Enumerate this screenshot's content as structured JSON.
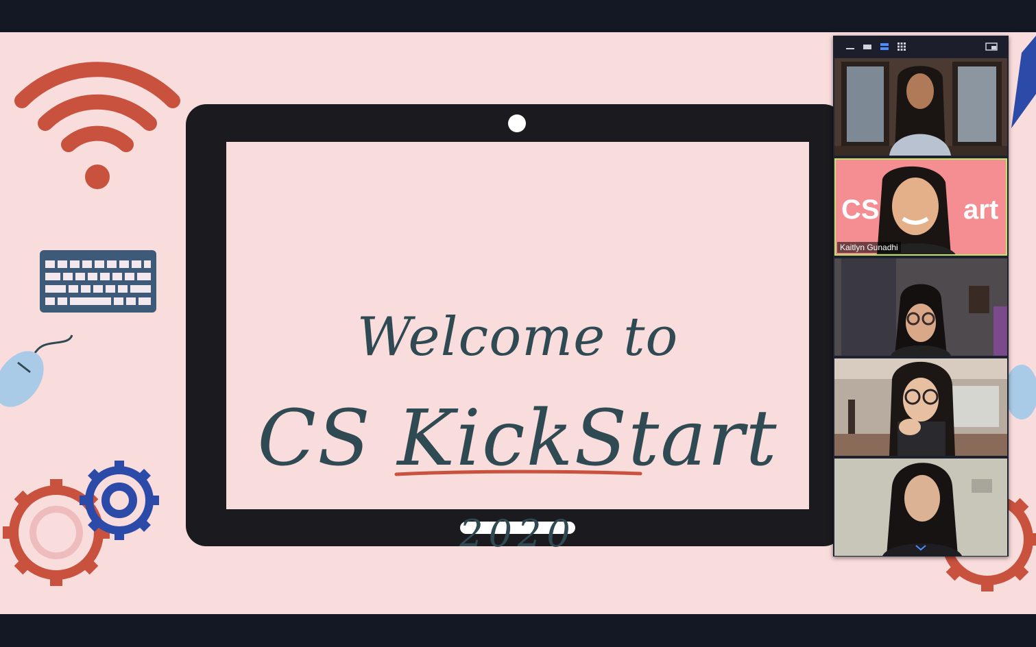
{
  "slide": {
    "line1": "Welcome to",
    "line2": "CS KickStart",
    "line3": "2020"
  },
  "colors": {
    "slide_bg": "#f9dcdc",
    "text": "#2f4a52",
    "accent_red": "#c9523f",
    "accent_blue": "#2c4aa8",
    "keyboard": "#3d5a78",
    "laptop": "#1b1b1f",
    "active_speaker": "#c4e466"
  },
  "gallery": {
    "toolbar_icons": [
      "minimize-icon",
      "thumbnail-view-icon",
      "speaker-view-icon",
      "gallery-view-icon",
      "exit-fullscreen-icon"
    ],
    "participants": [
      {
        "name": "",
        "active": false
      },
      {
        "name": "Kaitlyn Gunadhi",
        "active": true,
        "bg_text_left": "CS",
        "bg_text_right": "art"
      },
      {
        "name": "",
        "active": false
      },
      {
        "name": "",
        "active": false
      },
      {
        "name": "",
        "active": false
      }
    ],
    "scroll_icon": "chevron-down-icon"
  }
}
